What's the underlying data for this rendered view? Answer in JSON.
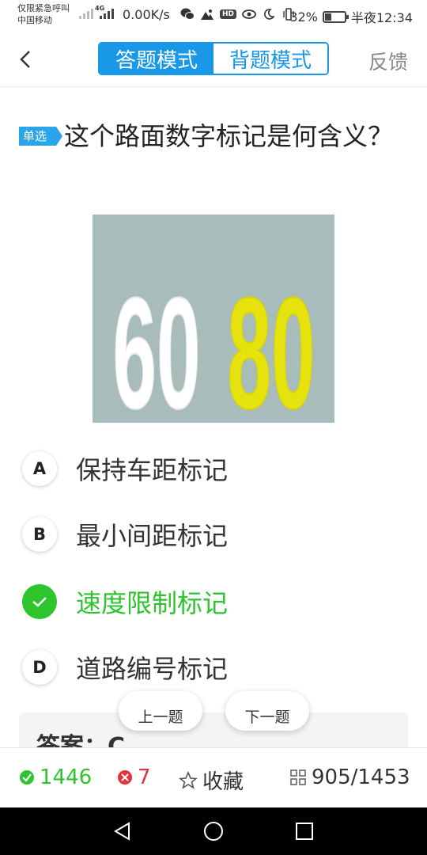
{
  "status_bar": {
    "emergency_text": "仅限紧急呼叫",
    "carrier": "中国移动",
    "network": "4G",
    "speed": "0.00K/s",
    "hd_badge": "HD",
    "battery_percent": "32%",
    "battery_level": 0.32,
    "time": "半夜12:34"
  },
  "header": {
    "tabs": [
      {
        "label": "答题模式",
        "active": true
      },
      {
        "label": "背题模式",
        "active": false
      }
    ],
    "feedback_label": "反馈"
  },
  "question": {
    "type_badge": "单选",
    "text": "这个路面数字标记是何含义？",
    "image_numbers": {
      "left": "60",
      "right": "80"
    },
    "image_colors": {
      "background": "#a9bcbc",
      "left": "#ffffff",
      "right": "#e6e20e"
    }
  },
  "options": [
    {
      "letter": "A",
      "text": "保持车距标记",
      "state": "normal"
    },
    {
      "letter": "B",
      "text": "最小间距标记",
      "state": "normal"
    },
    {
      "letter": "C",
      "text": "速度限制标记",
      "state": "correct"
    },
    {
      "letter": "D",
      "text": "道路编号标记",
      "state": "normal"
    }
  ],
  "answer": {
    "text": "答案：C"
  },
  "navigation": {
    "prev_label": "上一题",
    "next_label": "下一题"
  },
  "toolbar": {
    "correct_count": "1446",
    "wrong_count": "7",
    "favorite_label": "收藏",
    "progress": "905/1453"
  },
  "colors": {
    "accent": "#1a98e8",
    "correct": "#2dc42d",
    "wrong": "#e8303a"
  }
}
